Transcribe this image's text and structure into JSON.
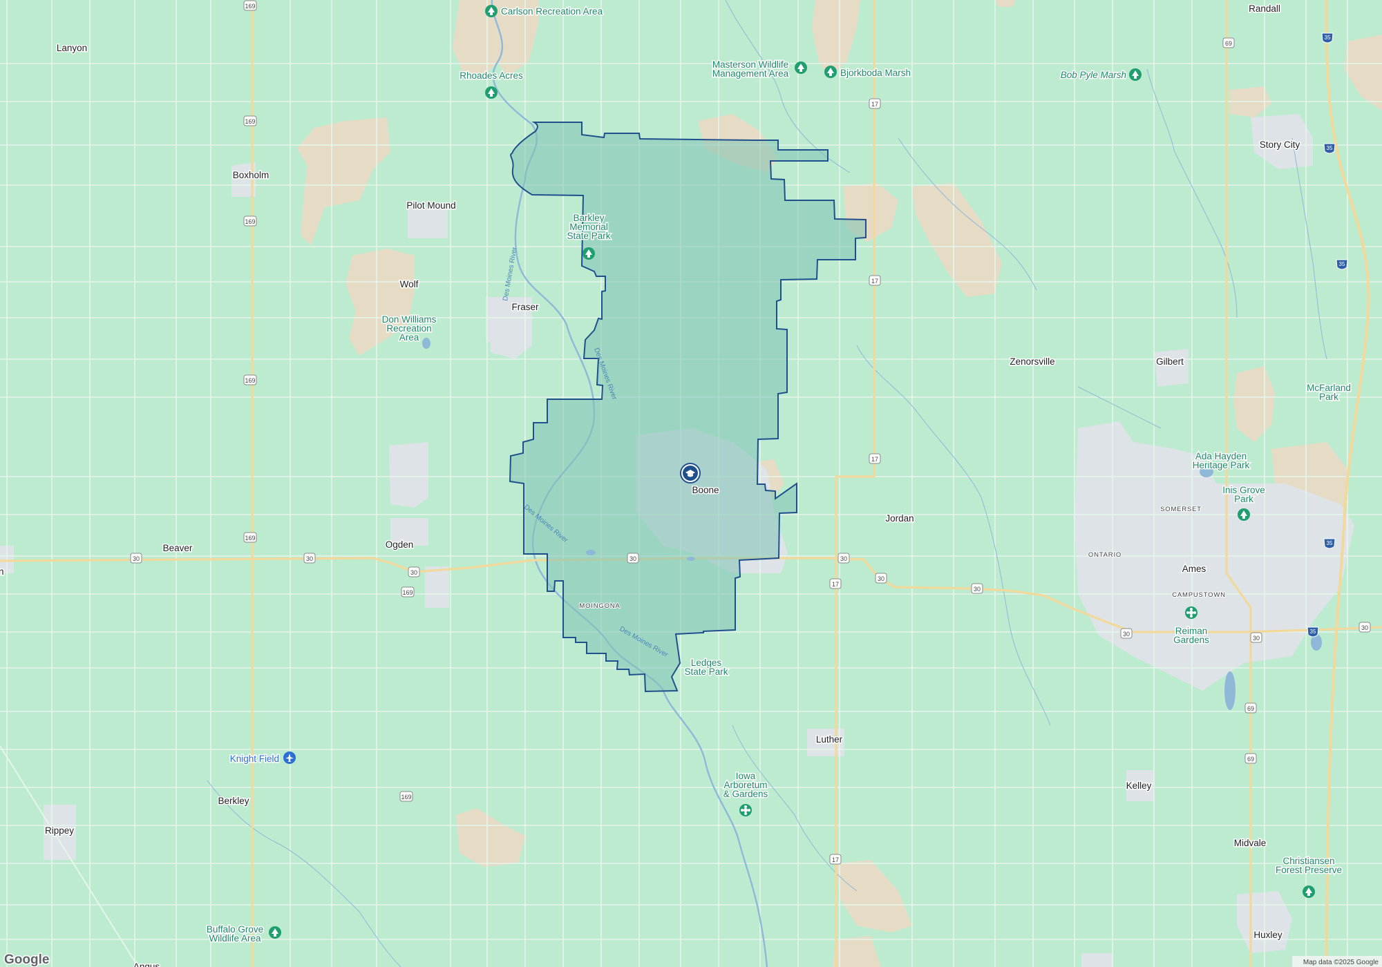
{
  "map": {
    "district": {
      "fill": "#7fc2b4",
      "stroke": "#1f4f8c",
      "icon": "school-icon"
    },
    "colors": {
      "background": "#bdebd0",
      "agricultural": "#e6dcc6",
      "urban": "#dde3e6",
      "roads": "#f2d89a",
      "grid_roads": "#e6f5ec",
      "water": "#8fb8d8",
      "poi": "#1f9e6f",
      "poi_text": "#1f8a68",
      "airport": "#2b6fd6"
    },
    "places": [
      {
        "name": "Randall",
        "kind": "town"
      },
      {
        "name": "Lanyon",
        "kind": "town"
      },
      {
        "name": "Story City",
        "kind": "city"
      },
      {
        "name": "Boxholm",
        "kind": "town"
      },
      {
        "name": "Pilot Mound",
        "kind": "town"
      },
      {
        "name": "Wolf",
        "kind": "town"
      },
      {
        "name": "Fraser",
        "kind": "town"
      },
      {
        "name": "Zenorsville",
        "kind": "town"
      },
      {
        "name": "Gilbert",
        "kind": "town"
      },
      {
        "name": "Boone",
        "kind": "city"
      },
      {
        "name": "Jordan",
        "kind": "town"
      },
      {
        "name": "Beaver",
        "kind": "town"
      },
      {
        "name": "Ogden",
        "kind": "town"
      },
      {
        "name": "Ames",
        "kind": "city"
      },
      {
        "name": "Luther",
        "kind": "town"
      },
      {
        "name": "Kelley",
        "kind": "town"
      },
      {
        "name": "Berkley",
        "kind": "town"
      },
      {
        "name": "Rippey",
        "kind": "town"
      },
      {
        "name": "Midvale",
        "kind": "town"
      },
      {
        "name": "Huxley",
        "kind": "town"
      },
      {
        "name": "Angus",
        "kind": "town"
      },
      {
        "name": "n",
        "kind": "town"
      }
    ],
    "neighborhoods": [
      "SOMERSET",
      "ONTARIO",
      "CAMPUSTOWN",
      "MOINGONA"
    ],
    "pois": [
      {
        "name": "Carlson Recreation Area",
        "icon": "park-icon"
      },
      {
        "name": "Rhoades Acres",
        "icon": "park-icon"
      },
      {
        "name": "Masterson Wildlife Management Area",
        "icon": "park-icon"
      },
      {
        "name": "Bjorkboda Marsh",
        "icon": "park-icon"
      },
      {
        "name": "Bob Pyle Marsh",
        "icon": "park-icon"
      },
      {
        "name": "Barkley Memorial State Park",
        "icon": "park-icon"
      },
      {
        "name": "Don Williams Recreation Area",
        "icon": "park-icon"
      },
      {
        "name": "McFarland Park",
        "icon": "park-icon"
      },
      {
        "name": "Ada Hayden Heritage Park",
        "icon": "park-icon"
      },
      {
        "name": "Inis Grove Park",
        "icon": "park-icon"
      },
      {
        "name": "Reiman Gardens",
        "icon": "garden-icon"
      },
      {
        "name": "Ledges State Park",
        "icon": "park-icon"
      },
      {
        "name": "Iowa Arboretum & Gardens",
        "icon": "garden-icon"
      },
      {
        "name": "Christiansen Forest Preserve",
        "icon": "park-icon"
      },
      {
        "name": "Buffalo Grove Wildlife Area",
        "icon": "park-icon"
      },
      {
        "name": "Knight Field",
        "icon": "airport-icon"
      }
    ],
    "rivers": [
      "Des Moines River"
    ],
    "highway_shields": [
      "169",
      "17",
      "30",
      "69",
      "35"
    ],
    "attribution": "Map data ©2025 Google",
    "logo": "Google"
  }
}
